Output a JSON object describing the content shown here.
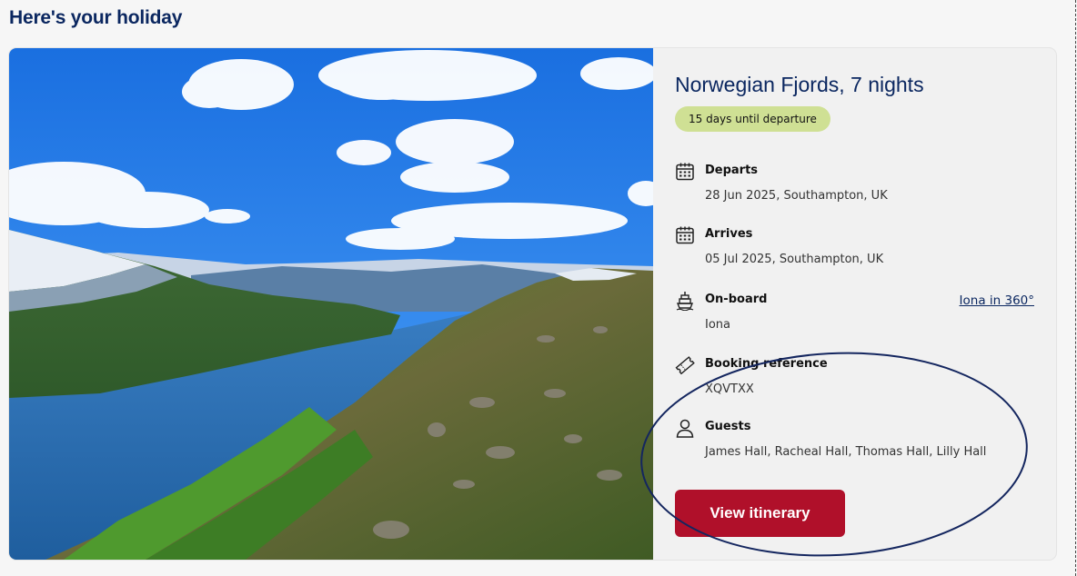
{
  "page": {
    "title": "Here's your holiday"
  },
  "holiday": {
    "title": "Norwegian Fjords, 7 nights",
    "badge": "15 days until departure",
    "departs": {
      "icon": "calendar-icon",
      "label": "Departs",
      "value": "28 Jun 2025, Southampton, UK"
    },
    "arrives": {
      "icon": "calendar-icon",
      "label": "Arrives",
      "value": "05 Jul 2025, Southampton, UK"
    },
    "onboard": {
      "icon": "ship-icon",
      "label": "On-board",
      "value": "Iona",
      "link_label": "Iona in 360°"
    },
    "booking": {
      "icon": "ticket-icon",
      "label": "Booking reference",
      "value": "XQVTXX"
    },
    "guests": {
      "icon": "person-icon",
      "label": "Guests",
      "value": "James Hall, Racheal Hall, Thomas Hall, Lilly Hall"
    },
    "cta_label": "View itinerary"
  },
  "colors": {
    "navy": "#0b2760",
    "badge_bg": "#cfe094",
    "cta_red": "#b0102a",
    "annotation": "#14265f"
  }
}
